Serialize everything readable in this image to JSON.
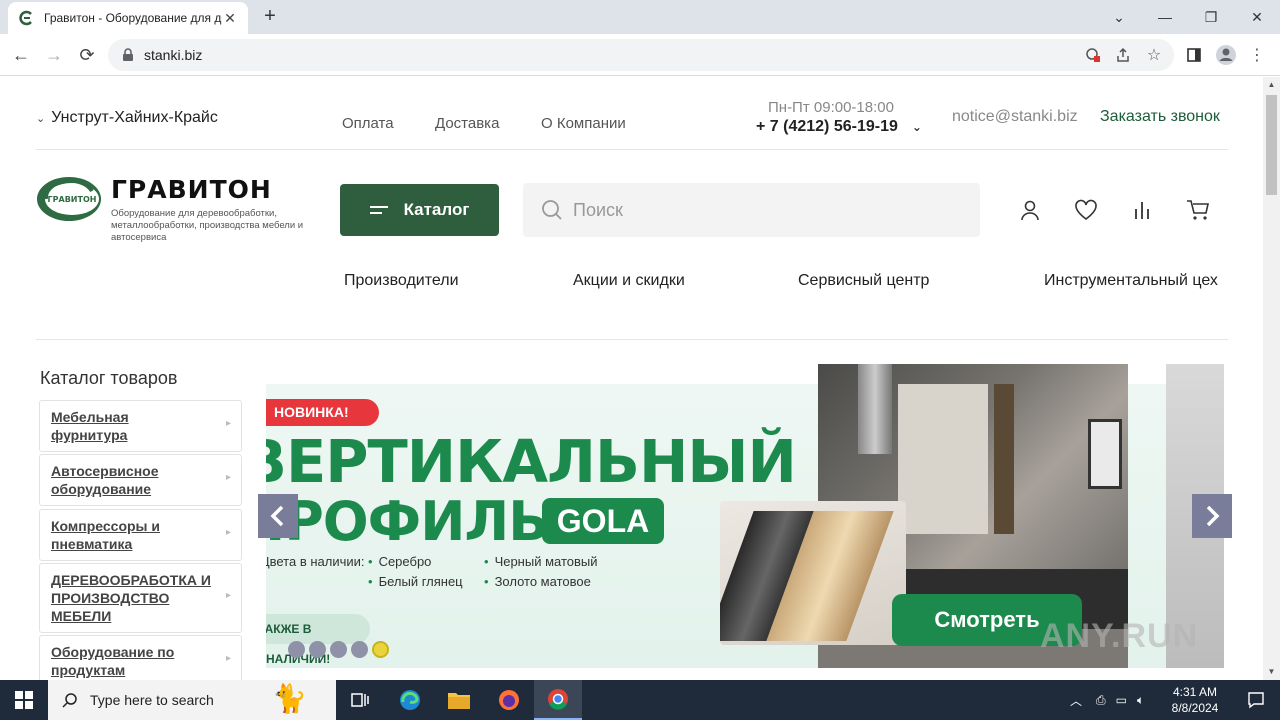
{
  "browser": {
    "tab_title": "Гравитон - Оборудование для деревообработки",
    "url": "stanki.biz"
  },
  "header": {
    "region": "Унструт-Хайних-Крайс",
    "nav": [
      "Оплата",
      "Доставка",
      "О Компании"
    ],
    "hours": "Пн-Пт 09:00-18:00",
    "phone": "+ 7 (4212) 56-19-19",
    "email": "notice@stanki.biz",
    "callback": "Заказать звонок"
  },
  "logo": {
    "mark_text": "ГРАВИТОН",
    "brand": "ГРАВИТОН",
    "tagline": "Оборудование для деревообработки, металлообработки, производства мебели и автосервиса"
  },
  "catalog_button": "Каталог",
  "search": {
    "placeholder": "Поиск"
  },
  "main_nav": [
    "Производители",
    "Акции и скидки",
    "Сервисный центр",
    "Инструментальный цех"
  ],
  "sidebar": {
    "title": "Каталог товаров",
    "items": [
      {
        "line1": "Мебельная",
        "line2": "фурнитура"
      },
      {
        "line1": "Автосервисное",
        "line2": "оборудование"
      },
      {
        "line1": "Компрессоры и",
        "line2": "пневматика"
      },
      {
        "line1": "ДЕРЕВООБРАБОТКА И",
        "line2": "ПРОИЗВОДСТВО",
        "line3": "МЕБЕЛИ"
      },
      {
        "line1": "Оборудование по",
        "line2": "продуктам"
      }
    ]
  },
  "banner": {
    "badge": "НОВИНКА!",
    "headline1": "ВЕРТИКАЛЬНЫЙ",
    "headline2": "ПРОФИЛЬ",
    "gola": "GOLA",
    "availability": "Цвета в наличии:",
    "colors": [
      "Серебро",
      "Белый глянец",
      "Черный матовый",
      "Золото матовое"
    ],
    "stock": "ТАКЖЕ В НАЛИЧИИ!",
    "cta": "Смотреть",
    "slide_count": 5,
    "active_slide": 5
  },
  "watermark": "ANY.RUN",
  "taskbar": {
    "search_placeholder": "Type here to search",
    "time": "4:31 AM",
    "date": "8/8/2024"
  }
}
